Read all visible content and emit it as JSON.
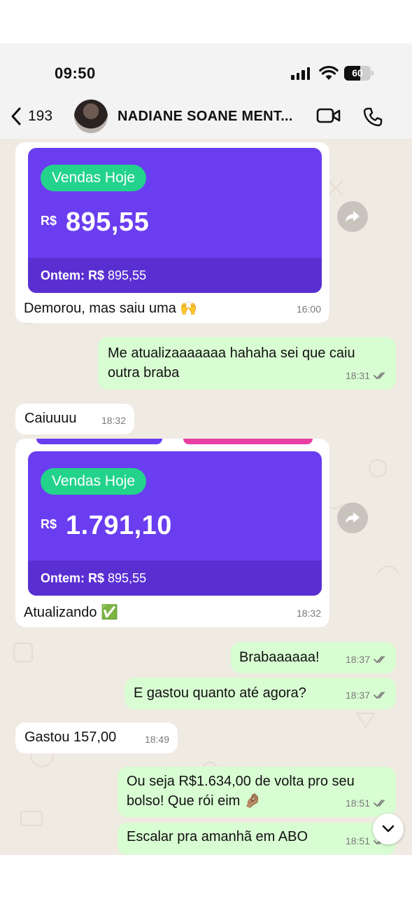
{
  "status_bar": {
    "time": "09:50",
    "battery": "60",
    "battery_level": 0.6
  },
  "header": {
    "back_count": "193",
    "contact_name": "NADIANE SOANE MENT..."
  },
  "messages": [
    {
      "direction": "in",
      "card": {
        "badge": "Vendas Hoje",
        "currency": "R$",
        "amount": "895,55",
        "footer_label": "Ontem: R$",
        "footer_value": "895,55"
      },
      "text": "Demorou, mas saiu uma 🙌",
      "time": "16:00"
    },
    {
      "direction": "out",
      "text": "Me atualizaaaaaaa hahaha sei que caiu outra braba",
      "time": "18:31"
    },
    {
      "direction": "in",
      "text": "Caiuuuu",
      "time": "18:32"
    },
    {
      "direction": "in",
      "card": {
        "badge": "Vendas Hoje",
        "currency": "R$",
        "amount": "1.791,10",
        "footer_label": "Ontem: R$",
        "footer_value": "895,55"
      },
      "text": "Atualizando ✅",
      "time": "18:32"
    },
    {
      "direction": "out",
      "text": "Brabaaaaaa!",
      "time": "18:37"
    },
    {
      "direction": "out",
      "text": "E gastou quanto até agora?",
      "time": "18:37"
    },
    {
      "direction": "in",
      "text": "Gastou 157,00",
      "time": "18:49"
    },
    {
      "direction": "out",
      "text": "Ou seja R$1.634,00 de volta pro seu bolso! Que rói eim 🤌🏽",
      "time": "18:51"
    },
    {
      "direction": "out",
      "text": "Escalar pra amanhã em ABO",
      "time": "18:51"
    }
  ],
  "colors": {
    "chat_bg": "#efeae2",
    "outgoing": "#d9fdd3",
    "incoming": "#ffffff",
    "card_purple": "#6a3df0",
    "badge_green": "#23d38c",
    "read_tick": "#53bdeb"
  },
  "icons": [
    "back-chevron-icon",
    "video-call-icon",
    "phone-call-icon",
    "forward-icon",
    "double-check-icon",
    "chevron-down-icon"
  ]
}
